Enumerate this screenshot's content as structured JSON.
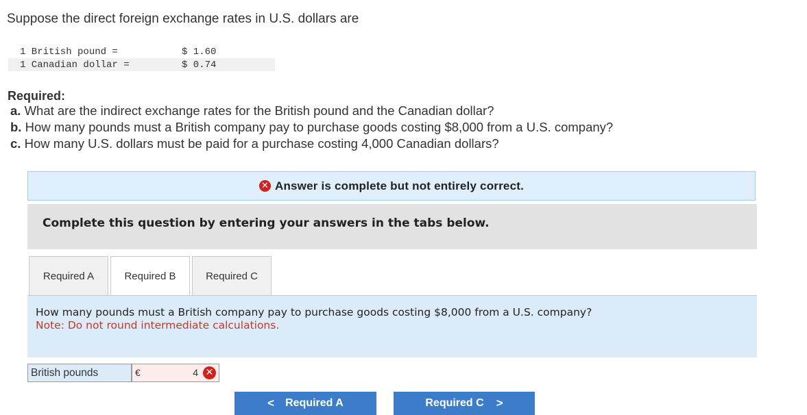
{
  "intro": "Suppose the direct foreign exchange rates in U.S. dollars are",
  "rates": [
    {
      "label": "1 British pound =",
      "value": "$ 1.60"
    },
    {
      "label": "1 Canadian dollar =",
      "value": "$ 0.74"
    }
  ],
  "required": {
    "heading": "Required:",
    "a_prefix": "a.",
    "a_text": "What are the indirect exchange rates for the British pound and the Canadian dollar?",
    "b_prefix": "b.",
    "b_text": "How many pounds must a British company pay to purchase goods costing $8,000 from a U.S. company?",
    "c_prefix": "c.",
    "c_text": "How many U.S. dollars must be paid for a purchase costing 4,000 Canadian dollars?"
  },
  "banner": {
    "icon": "x-circle-icon",
    "text": "Answer is complete but not entirely correct.",
    "icon_color": "#d22020"
  },
  "instruction": "Complete this question by entering your answers in the tabs below.",
  "tabs": [
    {
      "label": "Required A",
      "active": false
    },
    {
      "label": "Required B",
      "active": true
    },
    {
      "label": "Required C",
      "active": false
    }
  ],
  "panel": {
    "question": "How many pounds must a British company pay to purchase goods costing $8,000 from a U.S. company?",
    "note": "Note: Do not round intermediate calculations."
  },
  "answer": {
    "label": "British pounds",
    "currency": "€",
    "value": "4",
    "status": "incorrect"
  },
  "nav": {
    "prev_label": "Required A",
    "next_label": "Required C",
    "prev_icon": "<",
    "next_icon": ">"
  },
  "colors": {
    "accent": "#3d7cc9",
    "error": "#d22020",
    "note": "#c0392b"
  }
}
